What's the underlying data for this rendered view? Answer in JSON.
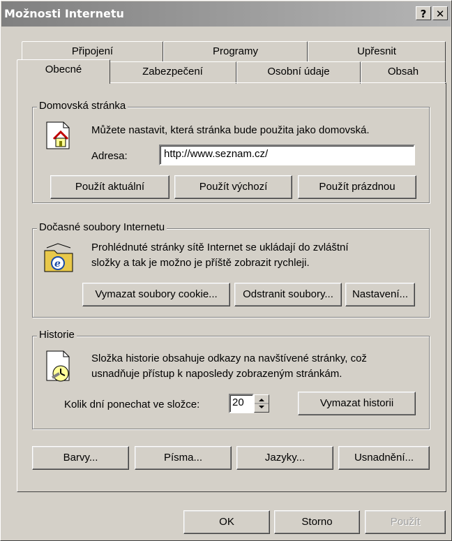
{
  "window": {
    "title": "Možnosti Internetu",
    "help_label": "?",
    "close_label": "✕"
  },
  "tabs": {
    "row1": [
      "Připojení",
      "Programy",
      "Upřesnit"
    ],
    "row2": [
      "Obecné",
      "Zabezpečení",
      "Osobní údaje",
      "Obsah"
    ],
    "active": "Obecné"
  },
  "home": {
    "legend": "Domovská stránka",
    "description": "Můžete nastavit, která stránka bude použita jako domovská.",
    "address_label": "Adresa:",
    "address_value": "http://www.seznam.cz/",
    "btn_current": "Použít aktuální",
    "btn_default": "Použít výchozí",
    "btn_blank": "Použít prázdnou"
  },
  "temp": {
    "legend": "Dočasné soubory Internetu",
    "description_line1": "Prohlédnuté stránky sítě Internet se ukládají do zvláštní",
    "description_line2": "složky a tak je možno je příště zobrazit rychleji.",
    "btn_cookies": "Vymazat soubory cookie...",
    "btn_delete": "Odstranit soubory...",
    "btn_settings": "Nastavení..."
  },
  "history": {
    "legend": "Historie",
    "description_line1": "Složka historie obsahuje odkazy na navštívené stránky, což",
    "description_line2": "usnadňuje přístup k naposledy zobrazeným stránkám.",
    "days_label": "Kolik dní ponechat ve složce:",
    "days_value": "20",
    "btn_clear": "Vymazat historii"
  },
  "bottom": {
    "colors": "Barvy...",
    "fonts": "Písma...",
    "languages": "Jazyky...",
    "accessibility": "Usnadnění..."
  },
  "dialog": {
    "ok": "OK",
    "cancel": "Storno",
    "apply": "Použít"
  }
}
